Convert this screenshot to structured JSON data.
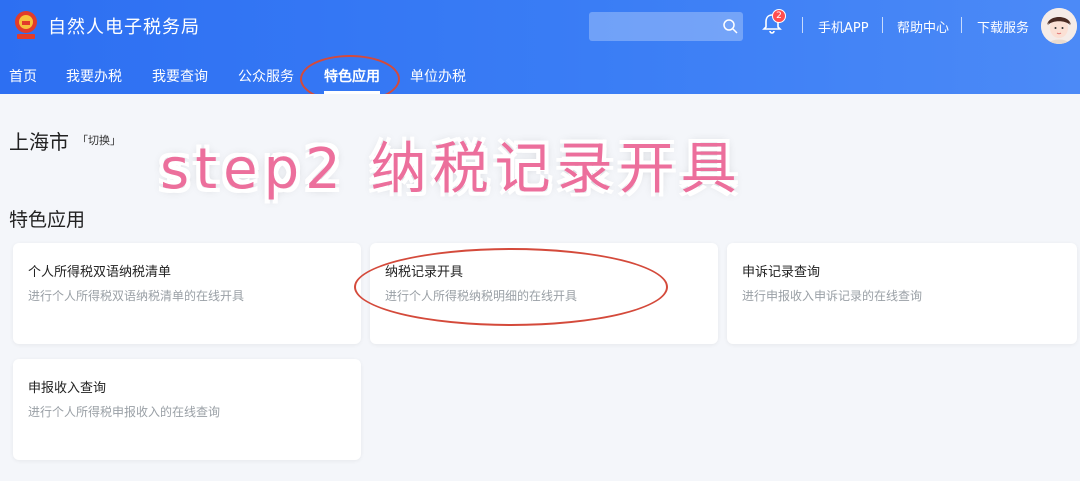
{
  "header": {
    "app_title": "自然人电子税务局",
    "search_placeholder": "",
    "notification_count": "2",
    "links": [
      "手机APP",
      "帮助中心",
      "下载服务"
    ]
  },
  "nav": {
    "items": [
      "首页",
      "我要办税",
      "我要查询",
      "公众服务",
      "特色应用",
      "单位办税"
    ],
    "active": "特色应用"
  },
  "region": {
    "city": "上海市",
    "switch_label": "「切换」"
  },
  "overlay": {
    "step_text": "step2 纳税记录开具"
  },
  "section": {
    "title": "特色应用"
  },
  "cards": [
    {
      "title": "个人所得税双语纳税清单",
      "desc": "进行个人所得税双语纳税清单的在线开具"
    },
    {
      "title": "纳税记录开具",
      "desc": "进行个人所得税纳税明细的在线开具"
    },
    {
      "title": "申诉记录查询",
      "desc": "进行申报收入申诉记录的在线查询"
    },
    {
      "title": "申报收入查询",
      "desc": "进行个人所得税申报收入的在线查询"
    }
  ],
  "colors": {
    "header_blue": "#3a7df5",
    "annotation_red": "#d44a3b",
    "overlay_pink": "#ec6f9c"
  },
  "icons": [
    "tax-emblem-icon",
    "search-icon",
    "bell-icon",
    "avatar"
  ]
}
